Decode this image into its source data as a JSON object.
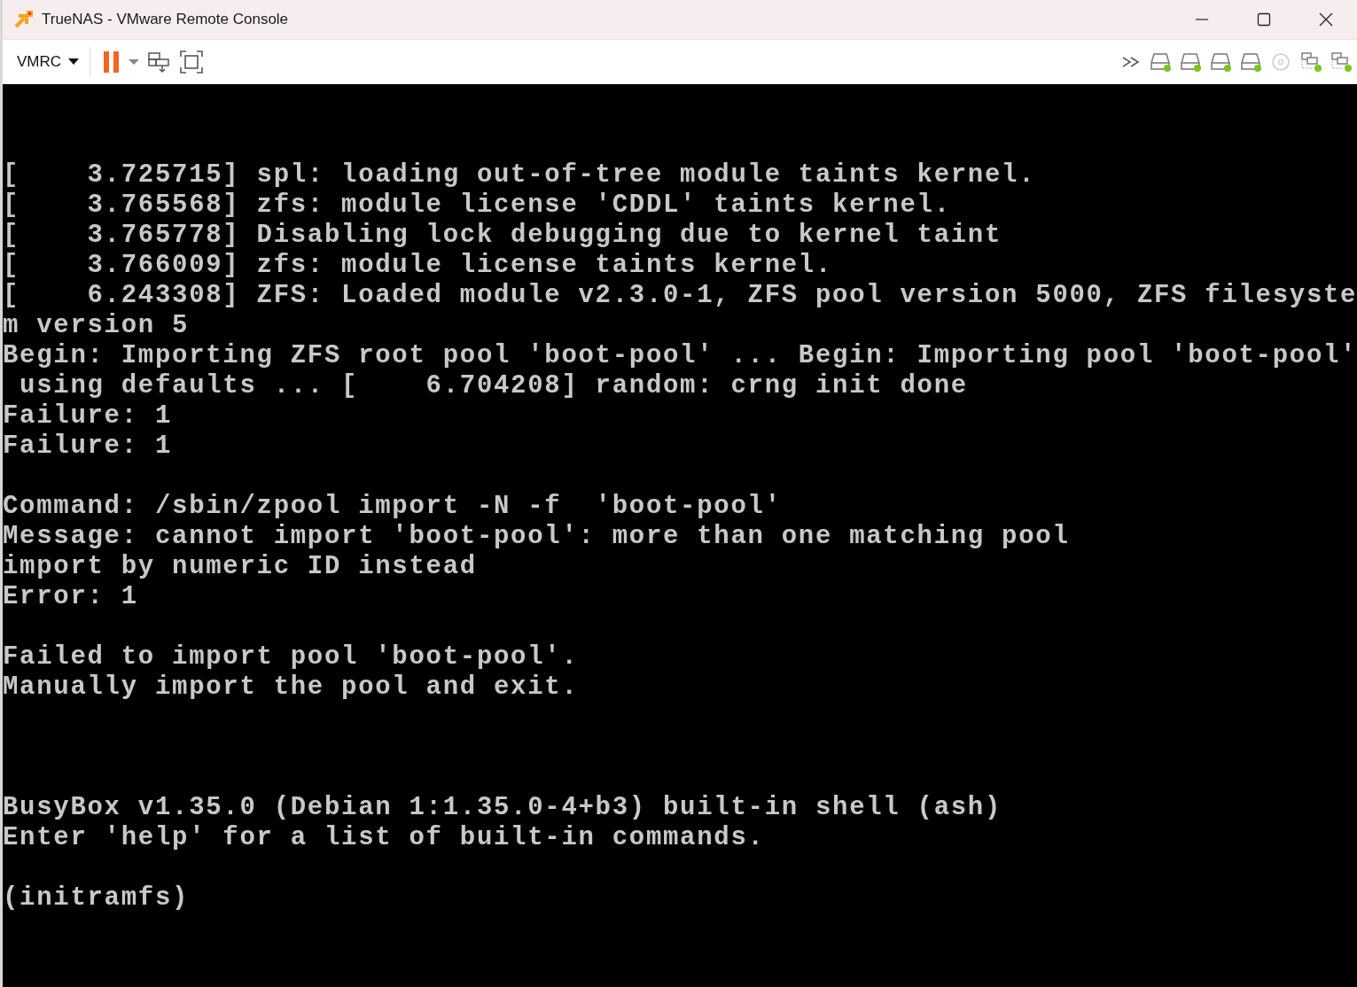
{
  "window": {
    "title": "TrueNAS - VMware Remote Console"
  },
  "toolbar": {
    "menu_label": "VMRC",
    "paused": true,
    "devices": [
      {
        "kind": "more"
      },
      {
        "kind": "disk",
        "connected": true
      },
      {
        "kind": "disk",
        "connected": true
      },
      {
        "kind": "disk",
        "connected": true
      },
      {
        "kind": "disk",
        "connected": true
      },
      {
        "kind": "cd",
        "connected": false
      },
      {
        "kind": "network",
        "connected": true
      },
      {
        "kind": "network",
        "connected": true
      }
    ]
  },
  "console": {
    "blocks": [
      {
        "kind": "log",
        "lines": [
          "[    3.725715] spl: loading out-of-tree module taints kernel.",
          "[    3.765568] zfs: module license 'CDDL' taints kernel.",
          "[    3.765778] Disabling lock debugging due to kernel taint",
          "[    3.766009] zfs: module license taints kernel.",
          "[    6.243308] ZFS: Loaded module v2.3.0-1, ZFS pool version 5000, ZFS filesyste",
          "m version 5",
          "Begin: Importing ZFS root pool 'boot-pool' ... Begin: Importing pool 'boot-pool'",
          " using defaults ... [    6.704208] random: crng init done",
          "Failure: 1",
          "Failure: 1"
        ]
      },
      {
        "kind": "message",
        "lines": [
          "Command: /sbin/zpool import -N -f  'boot-pool'",
          "Message: cannot import 'boot-pool': more than one matching pool",
          "import by numeric ID instead",
          "Error: 1"
        ]
      },
      {
        "kind": "message",
        "lines": [
          "Failed to import pool 'boot-pool'.",
          "Manually import the pool and exit."
        ]
      },
      {
        "kind": "banner",
        "lines": [
          "BusyBox v1.35.0 (Debian 1:1.35.0-4+b3) built-in shell (ash)",
          "Enter 'help' for a list of built-in commands."
        ]
      },
      {
        "kind": "message",
        "lines": [
          "(initramfs)"
        ]
      }
    ]
  }
}
